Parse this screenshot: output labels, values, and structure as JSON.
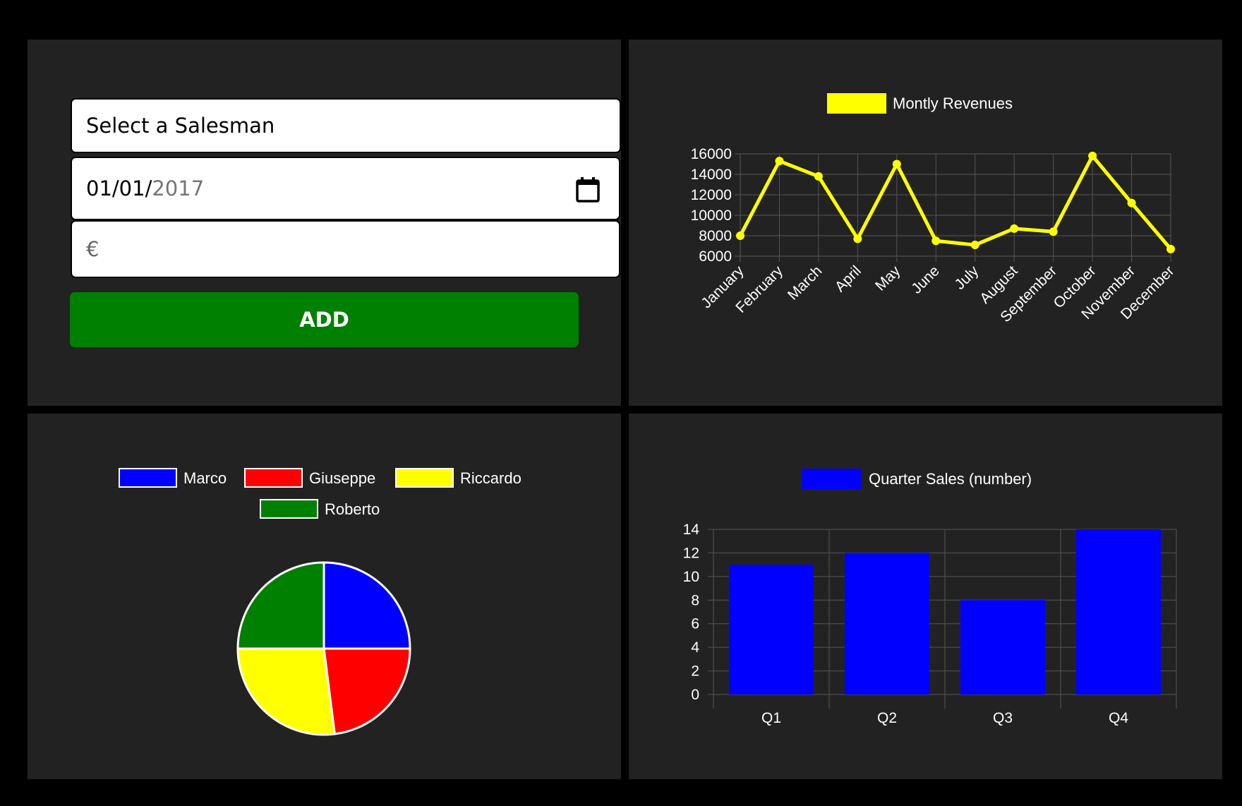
{
  "form": {
    "salesman_select": "Select a Salesman",
    "date": {
      "day_month": "01/01/",
      "year": "2017"
    },
    "amount_prefix": "€",
    "add_label": "ADD"
  },
  "colors": {
    "panel": "#222222",
    "revenue_line": "#ffff00",
    "quarter_bars": "#0000ff",
    "add_button": "#008000",
    "Marco": "#0000ff",
    "Giuseppe": "#ff0000",
    "Riccardo": "#ffff00",
    "Roberto": "#008000"
  },
  "chart_data": [
    {
      "type": "line",
      "series": [
        {
          "name": "Montly Revenues",
          "values": [
            8000,
            15300,
            13800,
            7700,
            15000,
            7500,
            7100,
            8700,
            8400,
            15800,
            11200,
            6700
          ]
        }
      ],
      "categories": [
        "January",
        "February",
        "March",
        "April",
        "May",
        "June",
        "July",
        "August",
        "September",
        "October",
        "November",
        "December"
      ],
      "yticks": [
        6000,
        8000,
        10000,
        12000,
        14000,
        16000
      ],
      "ylim": [
        6000,
        16000
      ],
      "grid": true,
      "legend": "top"
    },
    {
      "type": "pie",
      "labels": [
        "Marco",
        "Giuseppe",
        "Riccardo",
        "Roberto"
      ],
      "values": [
        25,
        23,
        27,
        25
      ],
      "legend": "top"
    },
    {
      "type": "bar",
      "series": [
        {
          "name": "Quarter Sales (number)",
          "values": [
            11,
            12,
            8,
            14
          ]
        }
      ],
      "categories": [
        "Q1",
        "Q2",
        "Q3",
        "Q4"
      ],
      "yticks": [
        0,
        2,
        4,
        6,
        8,
        10,
        12,
        14
      ],
      "ylim": [
        0,
        14
      ],
      "grid": true,
      "legend": "top"
    }
  ]
}
